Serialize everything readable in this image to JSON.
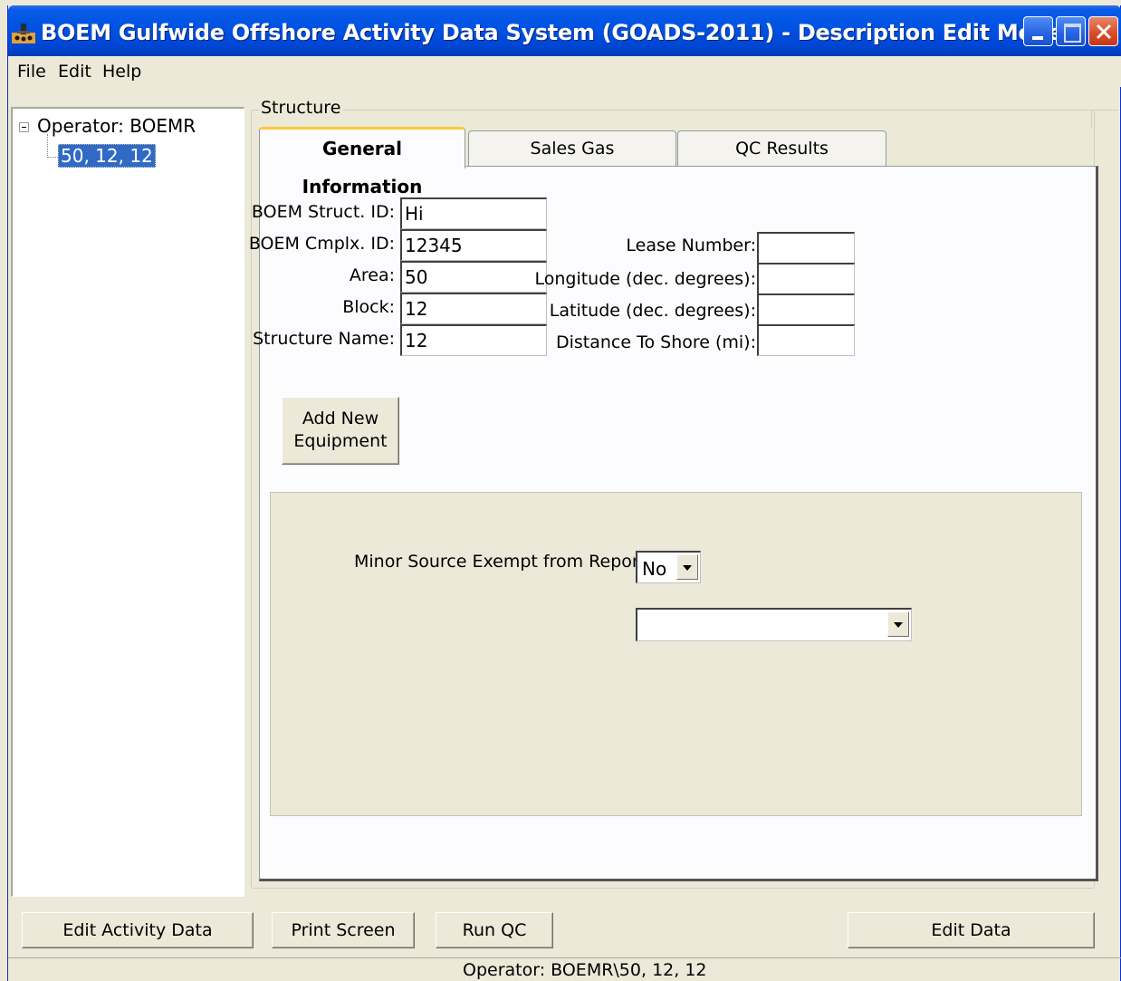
{
  "window": {
    "title": "BOEM Gulfwide Offshore Activity Data System (GOADS-2011) - Description Edit Mode"
  },
  "menu": [
    "File",
    "Edit",
    "Help"
  ],
  "tree": {
    "root": "Operator: BOEMR",
    "child": "50, 12, 12"
  },
  "structure": {
    "group_label": "Structure",
    "tabs": [
      "General Information",
      "Sales Gas",
      "QC Results"
    ],
    "active_tab": 0,
    "left_fields": [
      {
        "label": "BOEM Struct. ID:",
        "value": "Hi"
      },
      {
        "label": "BOEM Cmplx. ID:",
        "value": "12345"
      },
      {
        "label": "Area:",
        "value": "50"
      },
      {
        "label": "Block:",
        "value": "12"
      },
      {
        "label": "Structure Name:",
        "value": "12"
      }
    ],
    "right_fields": [
      {
        "label": "Lease Number:",
        "value": ""
      },
      {
        "label": "Longitude (dec. degrees):",
        "value": ""
      },
      {
        "label": "Latitude (dec. degrees):",
        "value": ""
      },
      {
        "label": "Distance To Shore (mi):",
        "value": ""
      }
    ],
    "add_equipment_label": "Add New\nEquipment",
    "minor_source_label": "Minor Source Exempt from Reporting:",
    "minor_source_value": "No",
    "secondary_select_value": ""
  },
  "buttons": {
    "edit_activity": "Edit Activity Data",
    "print_screen": "Print Screen",
    "run_qc": "Run QC",
    "edit_data": "Edit Data"
  },
  "status": "Operator: BOEMR\\50, 12, 12"
}
